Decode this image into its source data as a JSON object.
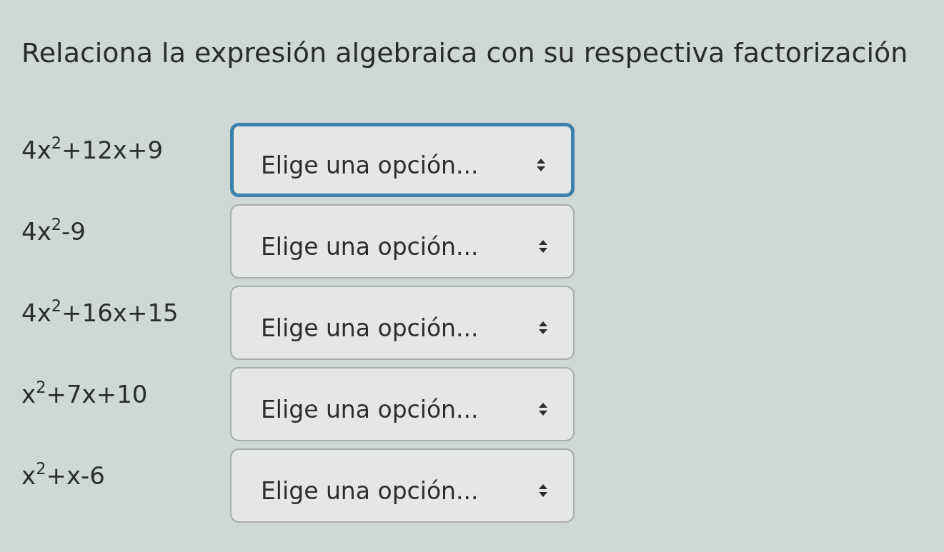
{
  "title": "Relaciona la expresión algebraica con su respectiva factorización",
  "rows": [
    {
      "expression": "4x$^{2}$+12x+9",
      "select": {
        "value": "Elige una opción...",
        "focused": true
      }
    },
    {
      "expression": "4x$^{2}$-9",
      "select": {
        "value": "Elige una opción...",
        "focused": false
      }
    },
    {
      "expression": "4x$^{2}$+16x+15",
      "select": {
        "value": "Elige una opción...",
        "focused": false
      }
    },
    {
      "expression": "x$^{2}$+7x+10",
      "select": {
        "value": "Elige una opción...",
        "focused": false
      }
    },
    {
      "expression": "x$^{2}$+x-6",
      "select": {
        "value": "Elige una opción...",
        "focused": false
      }
    }
  ]
}
